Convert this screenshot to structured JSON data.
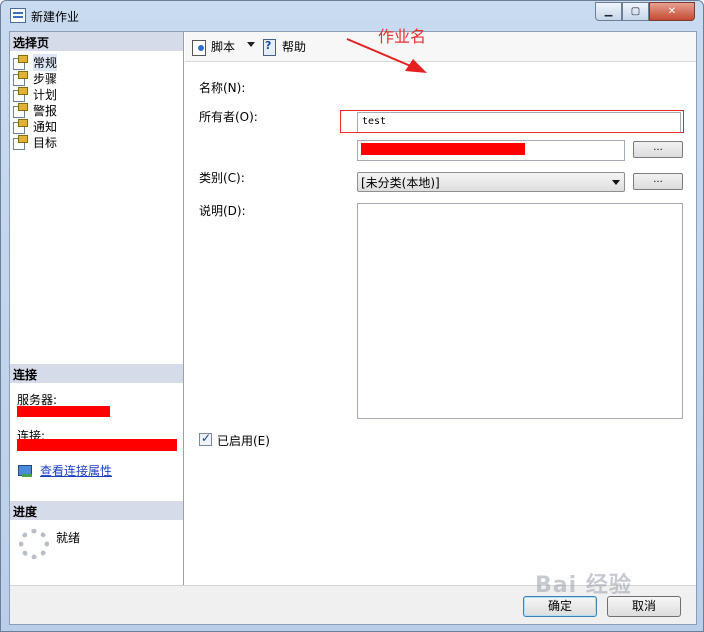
{
  "window": {
    "title": "新建作业",
    "controls": [
      "minimize-icon",
      "maximize-icon",
      "close-icon"
    ]
  },
  "left_pane": {
    "select_page_header": "选择页",
    "pages": [
      {
        "label": "常规",
        "selected": true
      },
      {
        "label": "步骤",
        "selected": false
      },
      {
        "label": "计划",
        "selected": false
      },
      {
        "label": "警报",
        "selected": false
      },
      {
        "label": "通知",
        "selected": false
      },
      {
        "label": "目标",
        "selected": false
      }
    ],
    "connection_header": "连接",
    "server_label": "服务器:",
    "connection_label": "连接:",
    "view_connection_link": "查看连接属性",
    "progress_header": "进度",
    "progress_status": "就绪"
  },
  "toolbar": {
    "script_label": "脚本",
    "help_label": "帮助"
  },
  "form": {
    "name_label": "名称(N):",
    "name_value": "test",
    "owner_label": "所有者(O):",
    "category_label": "类别(C):",
    "category_value": "[未分类(本地)]",
    "description_label": "说明(D):",
    "enabled_label": "已启用(E)",
    "enabled_checked": true,
    "browse_label": "..."
  },
  "annotation": {
    "text": "作业名",
    "color": "#e53030"
  },
  "buttons": {
    "ok": "确定",
    "cancel": "取消"
  },
  "watermark": "Bai 经验"
}
